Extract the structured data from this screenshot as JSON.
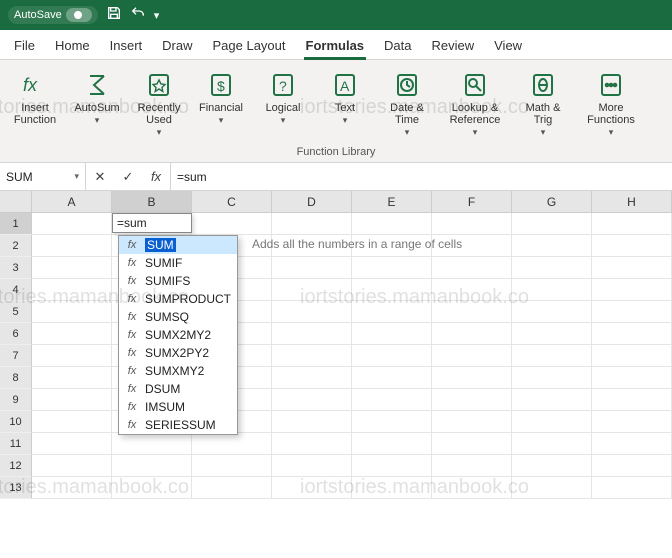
{
  "titlebar": {
    "autosave_label": "AutoSave",
    "autosave_on": false
  },
  "tabs": [
    {
      "label": "File",
      "active": false
    },
    {
      "label": "Home",
      "active": false
    },
    {
      "label": "Insert",
      "active": false
    },
    {
      "label": "Draw",
      "active": false
    },
    {
      "label": "Page Layout",
      "active": false
    },
    {
      "label": "Formulas",
      "active": true
    },
    {
      "label": "Data",
      "active": false
    },
    {
      "label": "Review",
      "active": false
    },
    {
      "label": "View",
      "active": false
    }
  ],
  "ribbon": {
    "group_label": "Function Library",
    "buttons": [
      {
        "label": "Insert\nFunction",
        "icon": "fx-icon"
      },
      {
        "label": "AutoSum",
        "icon": "sigma-icon"
      },
      {
        "label": "Recently\nUsed",
        "icon": "star-icon"
      },
      {
        "label": "Financial",
        "icon": "dollar-icon"
      },
      {
        "label": "Logical",
        "icon": "question-icon"
      },
      {
        "label": "Text",
        "icon": "letter-a-icon"
      },
      {
        "label": "Date &\nTime",
        "icon": "clock-icon"
      },
      {
        "label": "Lookup &\nReference",
        "icon": "lookup-icon"
      },
      {
        "label": "Math &\nTrig",
        "icon": "theta-icon"
      },
      {
        "label": "More\nFunctions",
        "icon": "ellipsis-icon"
      }
    ]
  },
  "editbar": {
    "namebox_value": "SUM",
    "formula_value": "=sum"
  },
  "grid": {
    "columns": [
      "A",
      "B",
      "C",
      "D",
      "E",
      "F",
      "G",
      "H"
    ],
    "rows": [
      "1",
      "2",
      "3",
      "4",
      "5",
      "6",
      "7",
      "8",
      "9",
      "10",
      "11",
      "12",
      "13"
    ],
    "active_col": "B",
    "active_row": "1",
    "cell_editor": {
      "value": "=sum"
    },
    "autocomplete": {
      "tip": "Adds all the numbers in a range of cells",
      "items": [
        {
          "label": "SUM",
          "selected": true
        },
        {
          "label": "SUMIF",
          "selected": false
        },
        {
          "label": "SUMIFS",
          "selected": false
        },
        {
          "label": "SUMPRODUCT",
          "selected": false
        },
        {
          "label": "SUMSQ",
          "selected": false
        },
        {
          "label": "SUMX2MY2",
          "selected": false
        },
        {
          "label": "SUMX2PY2",
          "selected": false
        },
        {
          "label": "SUMXMY2",
          "selected": false
        },
        {
          "label": "DSUM",
          "selected": false
        },
        {
          "label": "IMSUM",
          "selected": false
        },
        {
          "label": "SERIESSUM",
          "selected": false
        }
      ]
    }
  },
  "watermark": {
    "text": "iortstories.mamanbook.co"
  }
}
